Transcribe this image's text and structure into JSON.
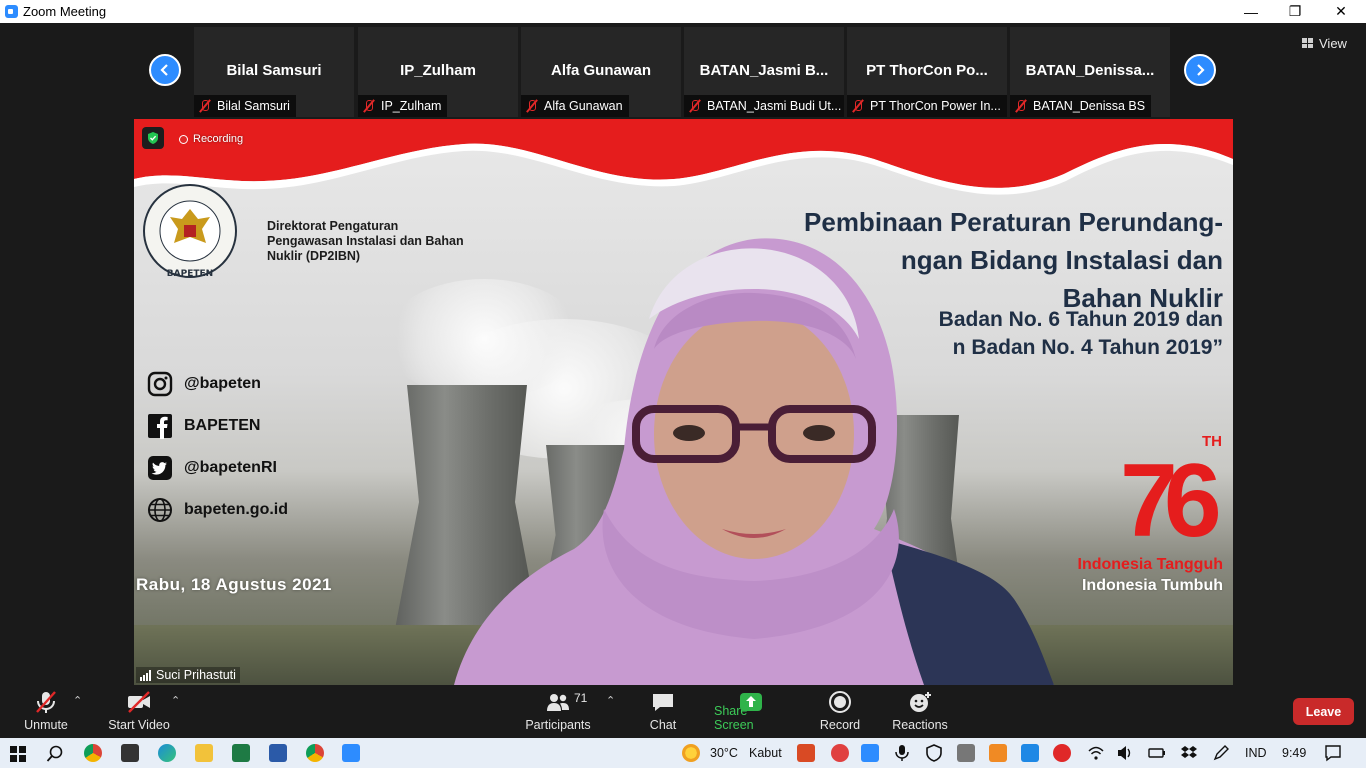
{
  "window": {
    "title": "Zoom Meeting",
    "minimize": "—",
    "restore": "❐",
    "close": "✕"
  },
  "view_button": {
    "label": "View"
  },
  "participants_strip": [
    {
      "name": "Bilal Samsuri",
      "label": "Bilal Samsuri"
    },
    {
      "name": "IP_Zulham",
      "label": "IP_Zulham"
    },
    {
      "name": "Alfa Gunawan",
      "label": "Alfa Gunawan"
    },
    {
      "name": "BATAN_Jasmi B...",
      "label": "BATAN_Jasmi Budi Ut..."
    },
    {
      "name": "PT ThorCon Po...",
      "label": "PT ThorCon Power In..."
    },
    {
      "name": "BATAN_Denissa...",
      "label": "BATAN_Denissa BS"
    }
  ],
  "video": {
    "recording_label": "Recording",
    "org_name": "Direktorat Pengaturan Pengawasan Instalasi dan Bahan Nuklir (DP2IBN)",
    "seal_text_top": "BADAN PENGAWAS TENAGA NUKLIR",
    "seal_text_bottom": "BAPETEN",
    "socials": [
      {
        "icon": "instagram-icon",
        "text": "@bapeten"
      },
      {
        "icon": "facebook-icon",
        "text": "BAPETEN"
      },
      {
        "icon": "twitter-icon",
        "text": "@bapetenRI"
      },
      {
        "icon": "globe-icon",
        "text": "bapeten.go.id"
      }
    ],
    "date": "Rabu, 18 Agustus 2021",
    "headline_lines": [
      "Pembinaan Peraturan Perundang-",
      "ngan Bidang Instalasi dan",
      "Bahan Nuklir"
    ],
    "subheadline_lines": [
      "Badan No. 6 Tahun 2019 dan",
      "n Badan No. 4 Tahun 2019”"
    ],
    "anniversary_number": "76",
    "anniversary_suffix": "TH",
    "tagline1": "Indonesia Tangguh",
    "tagline2": "Indonesia Tumbuh",
    "speaker": "Suci Prihastuti"
  },
  "toolbar": {
    "unmute": "Unmute",
    "start_video": "Start Video",
    "participants": "Participants",
    "participants_count": "71",
    "chat": "Chat",
    "share_screen": "Share Screen",
    "record": "Record",
    "reactions": "Reactions",
    "leave": "Leave"
  },
  "taskbar": {
    "weather_temp": "30°C",
    "weather_desc": "Kabut",
    "language": "IND",
    "time": "9:49"
  },
  "colors": {
    "zoom_blue": "#2d8cff",
    "leave_red": "#c92a2a",
    "share_green": "#2fb34a",
    "banner_red": "#e51d1d",
    "headline_navy": "#1f2f45"
  }
}
